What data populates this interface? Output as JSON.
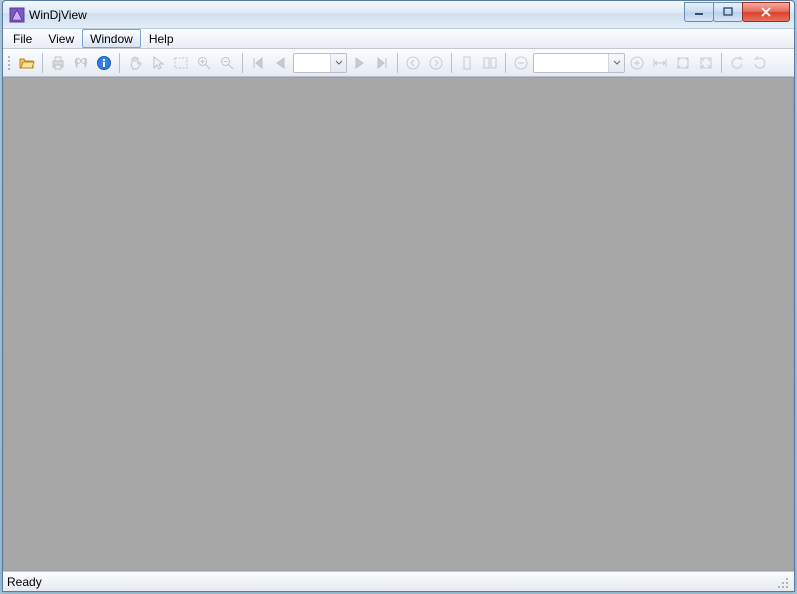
{
  "window": {
    "title": "WinDjView"
  },
  "menubar": {
    "items": [
      {
        "label": "File"
      },
      {
        "label": "View"
      },
      {
        "label": "Window",
        "active": true
      },
      {
        "label": "Help"
      }
    ]
  },
  "toolbar": {
    "page_combo": "",
    "zoom_combo": ""
  },
  "statusbar": {
    "text": "Ready"
  }
}
